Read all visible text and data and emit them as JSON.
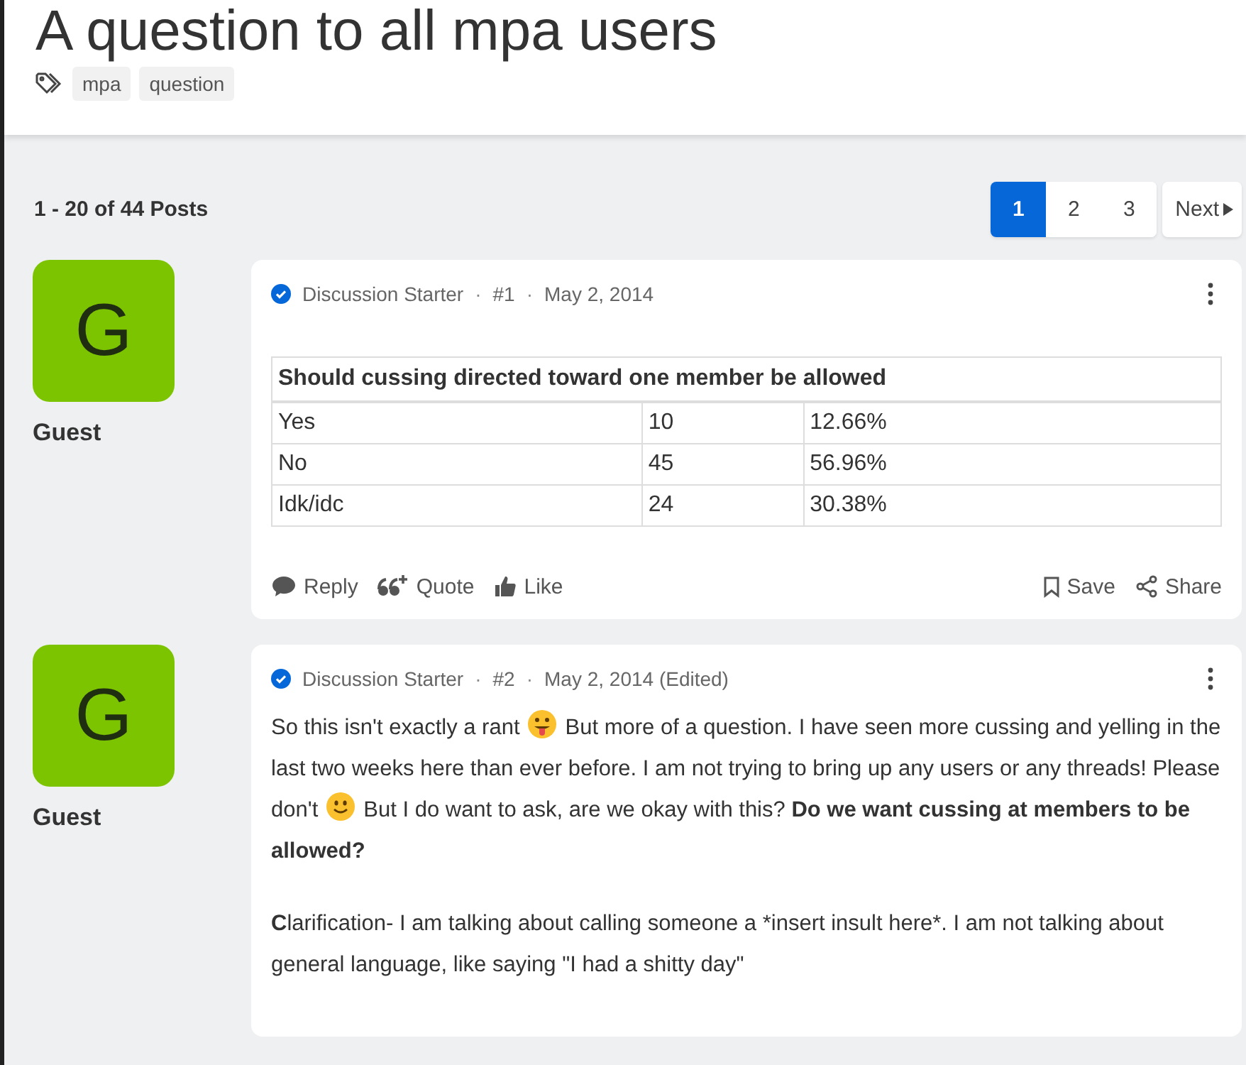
{
  "thread": {
    "title": "A question to all mpa users",
    "tags": [
      "mpa",
      "question"
    ]
  },
  "pagination": {
    "summary": "1 - 20 of 44 Posts",
    "pages": [
      {
        "label": "1",
        "selected": true
      },
      {
        "label": "2",
        "selected": false
      },
      {
        "label": "3",
        "selected": false
      }
    ],
    "next": "Next"
  },
  "posts": [
    {
      "avatar_letter": "G",
      "author": "Guest",
      "badge": "Discussion Starter",
      "separator_1": "·",
      "number": "#1",
      "separator_2": "·",
      "date": "May 2, 2014",
      "poll": {
        "title": "Should cussing directed toward one member be allowed",
        "rows": [
          [
            "Yes",
            "10",
            "12.66%"
          ],
          [
            "No",
            "45",
            "56.96%"
          ],
          [
            "Idk/idc",
            "24",
            "30.38%"
          ]
        ]
      },
      "actions": [
        "Reply",
        "Quote",
        "Like"
      ],
      "tools": [
        "Save",
        "Share"
      ]
    },
    {
      "avatar_letter": "G",
      "author": "Guest",
      "badge": "Discussion Starter",
      "separator_1": "·",
      "number": "#2",
      "separator_2": "·",
      "date": "May 2, 2014 (Edited)",
      "paragraphs": [
        [
          {
            "kind": "text",
            "text": "So this isn't exactly a rant"
          },
          {
            "kind": "tongue_emoji"
          },
          {
            "kind": "text",
            "text": "But more of a question. I have seen more cussing and yelling in the last two weeks here than ever before. I am not trying to bring up any users or any threads! Please don't"
          },
          {
            "kind": "smile_emoji"
          },
          {
            "kind": "text",
            "text": "But I do want to ask, are we okay with this? "
          },
          {
            "kind": "text",
            "text": "Do we want cussing at members to be allowed?",
            "bold": true
          }
        ],
        [
          {
            "kind": "text",
            "text": "C",
            "bold": true
          },
          {
            "kind": "text",
            "text": "larification- I am talking about calling someone a *insert insult here*. I am not talking about general language, like saying \"I had a shitty day\""
          }
        ]
      ]
    }
  ]
}
